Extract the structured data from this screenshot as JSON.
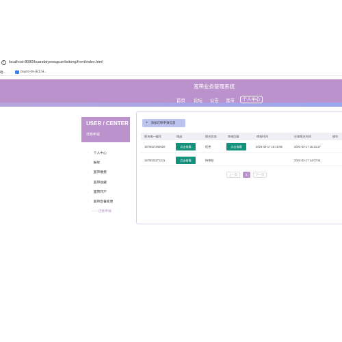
{
  "browser": {
    "url": "localhost:8080/kuandaiyewuguanlixitong/front/index.html",
    "bookmarks": [
      {
        "label": "础..."
      },
      {
        "label": "Day02-05-员工分..."
      }
    ]
  },
  "header": {
    "site_title": "宽带业务管理系统",
    "nav": [
      {
        "label": "首页"
      },
      {
        "label": "论坛"
      },
      {
        "label": "公告"
      },
      {
        "label": "宽带"
      },
      {
        "label": "个人中心"
      }
    ]
  },
  "sidebar": {
    "title": "USER / CENTER",
    "subtitle": "迁移申请",
    "items": [
      {
        "label": "个人中心"
      },
      {
        "label": "报修"
      },
      {
        "label": "宽带缴费"
      },
      {
        "label": "宽带收藏"
      },
      {
        "label": "宽带开户"
      },
      {
        "label": "宽带套餐变更"
      }
    ],
    "active_item": "——迁移申请"
  },
  "main": {
    "add_button": "添加迁移申请信息",
    "table": {
      "headers": [
        "报名唯一编号",
        "理由",
        "报名状态",
        "审核回复",
        "审核时间",
        "迁移报名时间",
        "操作"
      ],
      "rows": [
        {
          "id": "1679037292920",
          "reason_btn": "点击查看",
          "status": "拒绝",
          "reply_btn": "点击查看",
          "review_time": "2023-03-17 15:15:56",
          "apply_time": "2023-03-17 15:13:27"
        },
        {
          "id": "1679033271341",
          "reason_btn": "点击查看",
          "status": "待审核",
          "reply_btn": "",
          "review_time": "",
          "apply_time": "2023-03-17 14:07:51"
        }
      ]
    },
    "pagination": {
      "prev": "上一页",
      "current": "1",
      "next": "下一页"
    }
  }
}
